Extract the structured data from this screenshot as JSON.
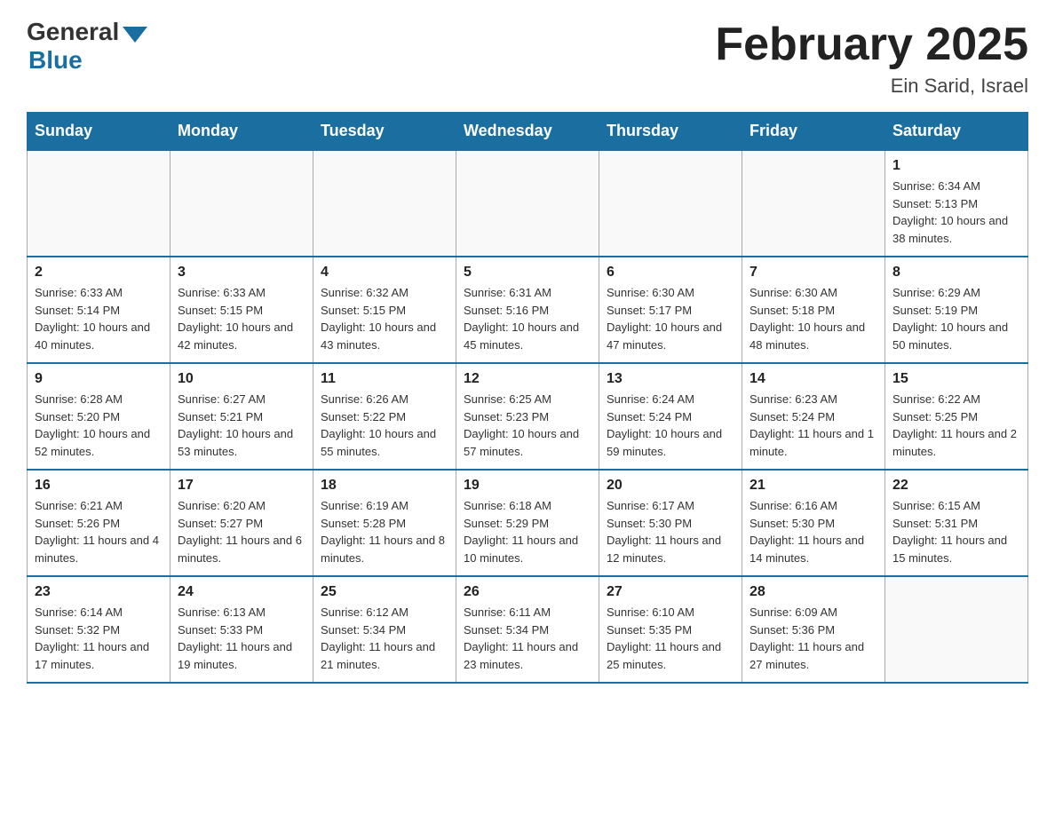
{
  "header": {
    "logo_general": "General",
    "logo_blue": "Blue",
    "title": "February 2025",
    "subtitle": "Ein Sarid, Israel"
  },
  "days_of_week": [
    "Sunday",
    "Monday",
    "Tuesday",
    "Wednesday",
    "Thursday",
    "Friday",
    "Saturday"
  ],
  "weeks": [
    [
      {
        "day": "",
        "info": ""
      },
      {
        "day": "",
        "info": ""
      },
      {
        "day": "",
        "info": ""
      },
      {
        "day": "",
        "info": ""
      },
      {
        "day": "",
        "info": ""
      },
      {
        "day": "",
        "info": ""
      },
      {
        "day": "1",
        "info": "Sunrise: 6:34 AM\nSunset: 5:13 PM\nDaylight: 10 hours and 38 minutes."
      }
    ],
    [
      {
        "day": "2",
        "info": "Sunrise: 6:33 AM\nSunset: 5:14 PM\nDaylight: 10 hours and 40 minutes."
      },
      {
        "day": "3",
        "info": "Sunrise: 6:33 AM\nSunset: 5:15 PM\nDaylight: 10 hours and 42 minutes."
      },
      {
        "day": "4",
        "info": "Sunrise: 6:32 AM\nSunset: 5:15 PM\nDaylight: 10 hours and 43 minutes."
      },
      {
        "day": "5",
        "info": "Sunrise: 6:31 AM\nSunset: 5:16 PM\nDaylight: 10 hours and 45 minutes."
      },
      {
        "day": "6",
        "info": "Sunrise: 6:30 AM\nSunset: 5:17 PM\nDaylight: 10 hours and 47 minutes."
      },
      {
        "day": "7",
        "info": "Sunrise: 6:30 AM\nSunset: 5:18 PM\nDaylight: 10 hours and 48 minutes."
      },
      {
        "day": "8",
        "info": "Sunrise: 6:29 AM\nSunset: 5:19 PM\nDaylight: 10 hours and 50 minutes."
      }
    ],
    [
      {
        "day": "9",
        "info": "Sunrise: 6:28 AM\nSunset: 5:20 PM\nDaylight: 10 hours and 52 minutes."
      },
      {
        "day": "10",
        "info": "Sunrise: 6:27 AM\nSunset: 5:21 PM\nDaylight: 10 hours and 53 minutes."
      },
      {
        "day": "11",
        "info": "Sunrise: 6:26 AM\nSunset: 5:22 PM\nDaylight: 10 hours and 55 minutes."
      },
      {
        "day": "12",
        "info": "Sunrise: 6:25 AM\nSunset: 5:23 PM\nDaylight: 10 hours and 57 minutes."
      },
      {
        "day": "13",
        "info": "Sunrise: 6:24 AM\nSunset: 5:24 PM\nDaylight: 10 hours and 59 minutes."
      },
      {
        "day": "14",
        "info": "Sunrise: 6:23 AM\nSunset: 5:24 PM\nDaylight: 11 hours and 1 minute."
      },
      {
        "day": "15",
        "info": "Sunrise: 6:22 AM\nSunset: 5:25 PM\nDaylight: 11 hours and 2 minutes."
      }
    ],
    [
      {
        "day": "16",
        "info": "Sunrise: 6:21 AM\nSunset: 5:26 PM\nDaylight: 11 hours and 4 minutes."
      },
      {
        "day": "17",
        "info": "Sunrise: 6:20 AM\nSunset: 5:27 PM\nDaylight: 11 hours and 6 minutes."
      },
      {
        "day": "18",
        "info": "Sunrise: 6:19 AM\nSunset: 5:28 PM\nDaylight: 11 hours and 8 minutes."
      },
      {
        "day": "19",
        "info": "Sunrise: 6:18 AM\nSunset: 5:29 PM\nDaylight: 11 hours and 10 minutes."
      },
      {
        "day": "20",
        "info": "Sunrise: 6:17 AM\nSunset: 5:30 PM\nDaylight: 11 hours and 12 minutes."
      },
      {
        "day": "21",
        "info": "Sunrise: 6:16 AM\nSunset: 5:30 PM\nDaylight: 11 hours and 14 minutes."
      },
      {
        "day": "22",
        "info": "Sunrise: 6:15 AM\nSunset: 5:31 PM\nDaylight: 11 hours and 15 minutes."
      }
    ],
    [
      {
        "day": "23",
        "info": "Sunrise: 6:14 AM\nSunset: 5:32 PM\nDaylight: 11 hours and 17 minutes."
      },
      {
        "day": "24",
        "info": "Sunrise: 6:13 AM\nSunset: 5:33 PM\nDaylight: 11 hours and 19 minutes."
      },
      {
        "day": "25",
        "info": "Sunrise: 6:12 AM\nSunset: 5:34 PM\nDaylight: 11 hours and 21 minutes."
      },
      {
        "day": "26",
        "info": "Sunrise: 6:11 AM\nSunset: 5:34 PM\nDaylight: 11 hours and 23 minutes."
      },
      {
        "day": "27",
        "info": "Sunrise: 6:10 AM\nSunset: 5:35 PM\nDaylight: 11 hours and 25 minutes."
      },
      {
        "day": "28",
        "info": "Sunrise: 6:09 AM\nSunset: 5:36 PM\nDaylight: 11 hours and 27 minutes."
      },
      {
        "day": "",
        "info": ""
      }
    ]
  ]
}
